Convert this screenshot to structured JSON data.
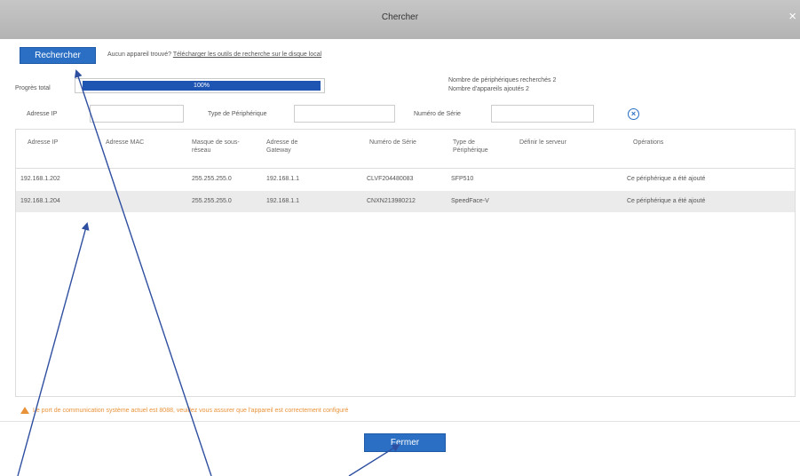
{
  "dialog": {
    "title": "Chercher",
    "close_glyph": "×",
    "search_button": "Rechercher",
    "no_device_text": "Aucun appareil trouvé?",
    "download_link": "Télécharger les outils de recherche sur le disque local",
    "progress": {
      "label": "Progrès total",
      "value_text": "100%",
      "fraction": 1.0
    },
    "stats": {
      "searched": "Nombre de périphériques recherchés 2",
      "added": "Nombre d'appareils ajoutés 2"
    },
    "filters": {
      "ip_label": "Adresse IP",
      "type_label": "Type de Périphérique",
      "serial_label": "Numéro de Série",
      "clear_icon": "circle-x-icon"
    },
    "table": {
      "headers": [
        "Adresse IP",
        "Adresse MAC",
        "Masque de sous-réseau",
        "Adresse de Gateway",
        "Numéro de Série",
        "Type de Périphérique",
        "Définir le serveur",
        "Opérations"
      ],
      "rows": [
        [
          "192.168.1.202",
          "",
          "255.255.255.0",
          "192.168.1.1",
          "CLVF204480083",
          "SFP510",
          "",
          "Ce périphérique a été ajouté"
        ],
        [
          "192.168.1.204",
          "",
          "255.255.255.0",
          "192.168.1.1",
          "CNXN213980212",
          "SpeedFace-V",
          "",
          "Ce périphérique a été ajouté"
        ]
      ]
    },
    "warning": "Le port de communication système actuel est 8088, veuillez vous assurer que l'appareil est correctement configuré",
    "close_button": "Fermer",
    "colors": {
      "accent": "#2a6fc3",
      "progress": "#1e55b3",
      "warning": "#e8933a",
      "annotation": "#2f4fa0"
    }
  }
}
